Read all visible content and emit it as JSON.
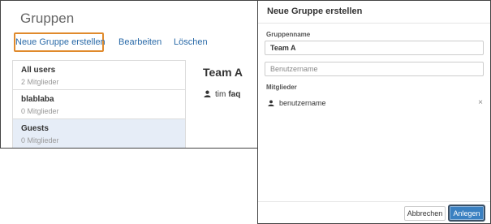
{
  "groups_page": {
    "title": "Gruppen",
    "actions": {
      "create": "Neue Gruppe erstellen",
      "edit": "Bearbeiten",
      "delete": "Löschen"
    },
    "groups": [
      {
        "name": "All users",
        "count": "2 Mitglieder"
      },
      {
        "name": "blablaba",
        "count": "0 Mitglieder"
      },
      {
        "name": "Guests",
        "count": "0 Mitglieder"
      }
    ],
    "selected_group": {
      "title": "Team A",
      "member_name": "tim",
      "member_extra": "faq"
    }
  },
  "dialog": {
    "title": "Neue Gruppe erstellen",
    "group_name_label": "Gruppenname",
    "group_name_value": "Team A",
    "username_placeholder": "Benutzername",
    "members_label": "Mitglieder",
    "members": [
      {
        "name": "benutzername"
      }
    ],
    "remove_symbol": "×",
    "cancel_label": "Abbrechen",
    "create_label": "Anlegen"
  },
  "colors": {
    "link": "#2a6aa8",
    "highlight_border": "#e08a2c",
    "selected_row": "#e6edf7",
    "primary_button": "#3a80c1"
  },
  "icons": {
    "member": "user-icon",
    "remove": "close-icon"
  }
}
